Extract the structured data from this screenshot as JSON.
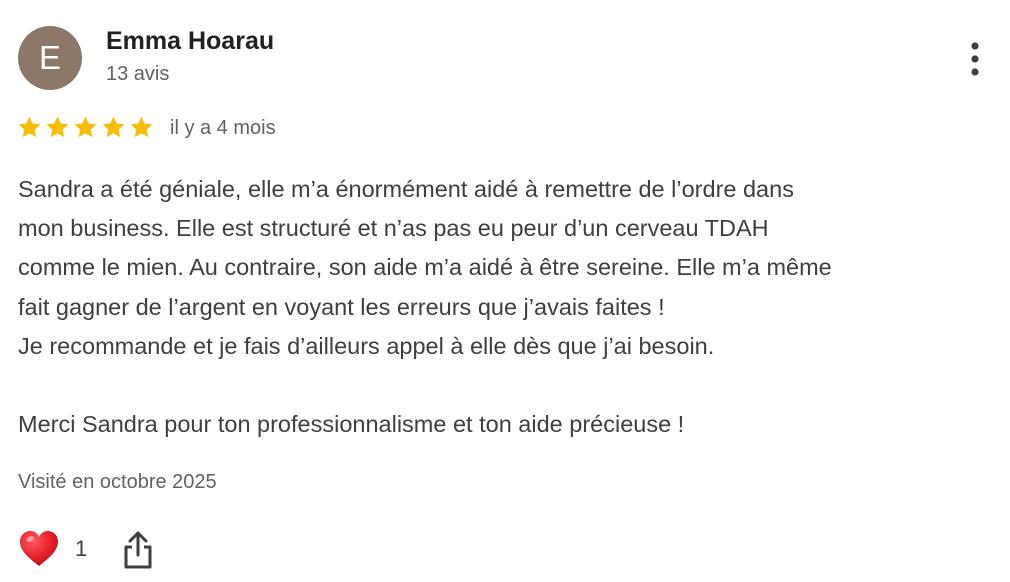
{
  "review": {
    "author": {
      "initial": "E",
      "name": "Emma Hoarau",
      "review_count": "13 avis",
      "avatar_color": "#8d7769"
    },
    "rating": {
      "stars": 5,
      "max_stars": 5,
      "star_color": "#fbbc04"
    },
    "date": "il y a 4 mois",
    "text": "Sandra a été géniale, elle m’a énormément aidé à remettre de l’ordre dans\nmon business. Elle est structuré et n’as pas eu peur d’un cerveau TDAH\ncomme le mien. Au contraire, son aide m’a aidé à être sereine. Elle m’a même\nfait gagner de l’argent en voyant les erreurs que j’avais faites !\nJe recommande et je fais d’ailleurs appel à elle dès que j’ai besoin.\n\nMerci Sandra pour ton professionnalisme et ton aide précieuse !",
    "visit": "Visité en octobre 2025",
    "reactions": {
      "like_icon": "red-heart-icon",
      "like_count": "1",
      "heart_color": "#e8202b"
    },
    "icons": {
      "more": "more-vertical-icon",
      "share": "share-icon"
    }
  }
}
